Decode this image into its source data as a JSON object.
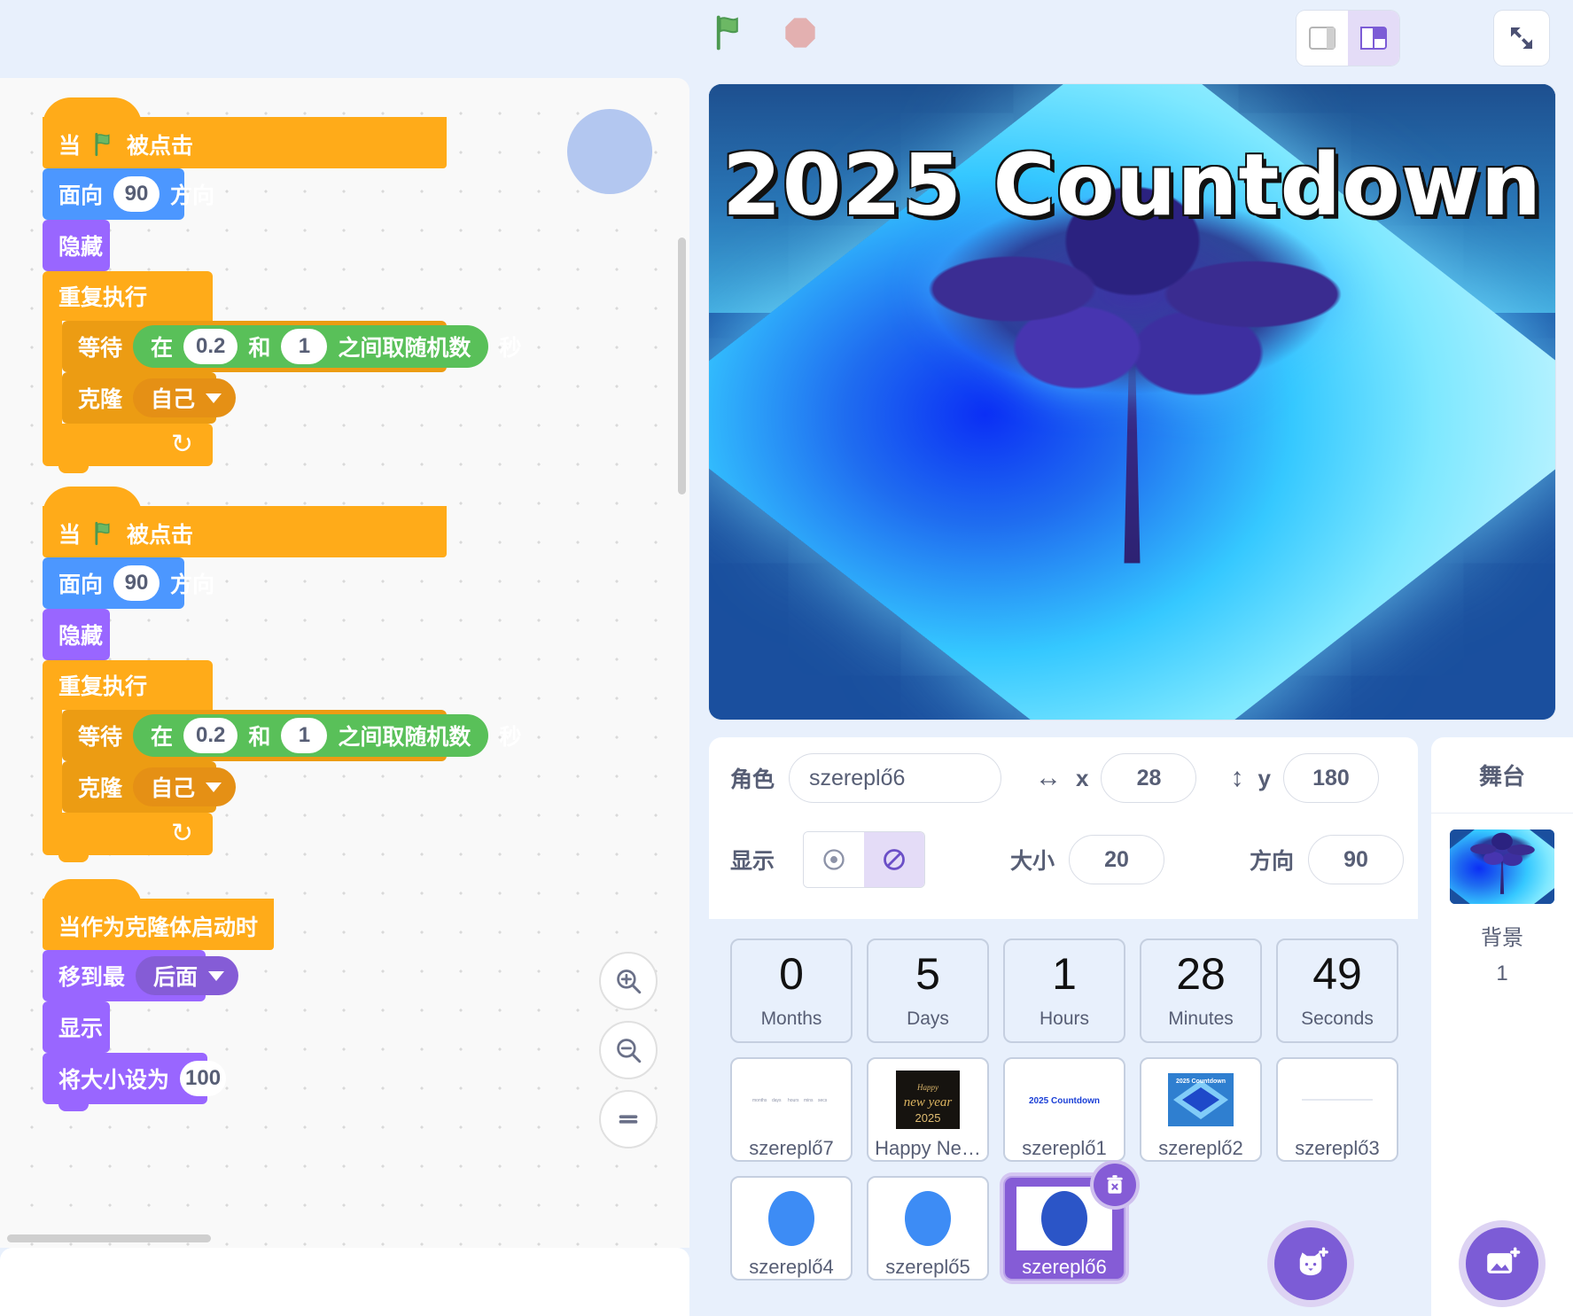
{
  "toolbar": {
    "green_flag_icon": "green-flag-icon",
    "stop_icon": "stop-octagon-icon",
    "layout_small_icon": "layout-small-stage-icon",
    "layout_large_icon": "layout-large-stage-icon",
    "fullscreen_icon": "fullscreen-icon"
  },
  "workspace": {
    "zoom_in_icon": "zoom-in-icon",
    "zoom_out_icon": "zoom-out-icon",
    "zoom_reset_icon": "zoom-reset-icon",
    "scripts": [
      {
        "id": "script-1",
        "blocks": [
          {
            "type": "hat",
            "prefix": "当",
            "icon": "green-flag-icon",
            "suffix": "被点击"
          },
          {
            "type": "motion",
            "prefix": "面向",
            "value": "90",
            "suffix": "方向"
          },
          {
            "type": "looks",
            "label": "隐藏"
          },
          {
            "type": "c-loop",
            "label": "重复执行",
            "children": [
              {
                "type": "control-wait",
                "prefix": "等待",
                "reporter": {
                  "a": "在",
                  "min": "0.2",
                  "b": "和",
                  "max": "1",
                  "c": "之间取随机数"
                },
                "suffix": "秒"
              },
              {
                "type": "control-clone",
                "prefix": "克隆",
                "dropdown": "自己"
              }
            ]
          }
        ]
      },
      {
        "id": "script-2",
        "blocks": [
          {
            "type": "hat",
            "prefix": "当",
            "icon": "green-flag-icon",
            "suffix": "被点击"
          },
          {
            "type": "motion",
            "prefix": "面向",
            "value": "90",
            "suffix": "方向"
          },
          {
            "type": "looks",
            "label": "隐藏"
          },
          {
            "type": "c-loop",
            "label": "重复执行",
            "children": [
              {
                "type": "control-wait",
                "prefix": "等待",
                "reporter": {
                  "a": "在",
                  "min": "0.2",
                  "b": "和",
                  "max": "1",
                  "c": "之间取随机数"
                },
                "suffix": "秒"
              },
              {
                "type": "control-clone",
                "prefix": "克隆",
                "dropdown": "自己"
              }
            ]
          }
        ]
      },
      {
        "id": "script-3",
        "blocks": [
          {
            "type": "hat",
            "label": "当作为克隆体启动时"
          },
          {
            "type": "looks-dd",
            "prefix": "移到最",
            "dropdown": "后面"
          },
          {
            "type": "looks",
            "label": "显示"
          },
          {
            "type": "looks-val",
            "prefix": "将大小设为",
            "value": "100"
          }
        ]
      }
    ]
  },
  "stage": {
    "title": "2025 Countdown"
  },
  "sprite_info": {
    "name_label": "角色",
    "name_value": "szereplő6",
    "x_label": "x",
    "x_value": "28",
    "y_label": "y",
    "y_value": "180",
    "show_label": "显示",
    "show_icon": "eye-show-icon",
    "hide_icon": "eye-hide-icon",
    "size_label": "大小",
    "size_value": "20",
    "direction_label": "方向",
    "direction_value": "90"
  },
  "countdown": [
    {
      "value": "0",
      "unit": "Months"
    },
    {
      "value": "5",
      "unit": "Days"
    },
    {
      "value": "1",
      "unit": "Hours"
    },
    {
      "value": "28",
      "unit": "Minutes"
    },
    {
      "value": "49",
      "unit": "Seconds"
    }
  ],
  "sprites_row1": [
    {
      "name": "szereplő7",
      "thumb": "dashes-thumb",
      "selected": false
    },
    {
      "name": "Happy Ne…",
      "thumb": "new-year-2025-thumb",
      "selected": false
    },
    {
      "name": "szereplő1",
      "thumb": "countdown-text-thumb",
      "selected": false
    },
    {
      "name": "szereplő2",
      "thumb": "countdown-img-thumb",
      "selected": false
    },
    {
      "name": "szereplő3",
      "thumb": "blank-line-thumb",
      "selected": false
    }
  ],
  "sprites_row2": [
    {
      "name": "szereplő4",
      "thumb": "blue-circle-thumb",
      "selected": false
    },
    {
      "name": "szereplő5",
      "thumb": "blue-circle-thumb",
      "selected": false
    },
    {
      "name": "szereplő6",
      "thumb": "blue-circle-dark-thumb",
      "selected": true
    }
  ],
  "add_sprite": {
    "icon": "cat-add-icon"
  },
  "stage_panel": {
    "title": "舞台",
    "backdrop_label": "背景",
    "backdrop_count": "1",
    "add_backdrop_icon": "image-add-icon"
  },
  "colors": {
    "accent_purple": "#855cd6",
    "control_orange": "#ffab19",
    "motion_blue": "#4c97ff",
    "looks_purple": "#9966ff",
    "operator_green": "#59c059",
    "panel_bg": "#e8f0fc"
  }
}
